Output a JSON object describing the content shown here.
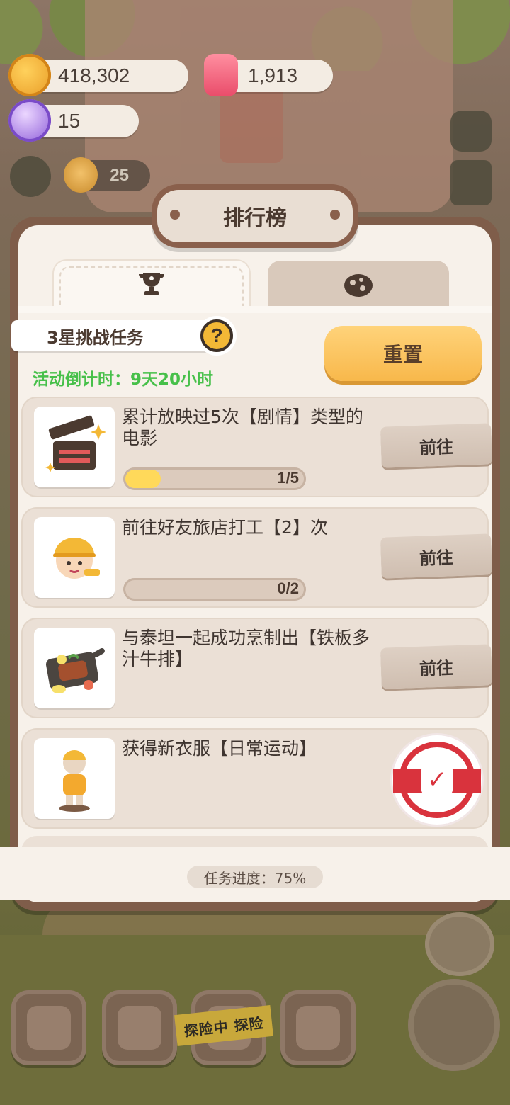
{
  "currencies": {
    "cookie": "418,302",
    "candle": "1,913",
    "gem": "15"
  },
  "level_chip": {
    "value": "25"
  },
  "panel": {
    "title": "排行榜",
    "tabs": [
      {
        "icon": "trophy-icon",
        "active": true
      },
      {
        "icon": "ball-icon",
        "active": false
      }
    ],
    "challenge_label": "3星挑战任务",
    "help_label": "?",
    "countdown": "活动倒计时：9天20小时",
    "reset_label": "重置",
    "tasks": [
      {
        "desc": "累计放映过5次【剧情】类型的电影",
        "progress": 0.2,
        "count": "1/5",
        "button": "前往",
        "icon": "clapperboard-icon"
      },
      {
        "desc": "前往好友旅店打工【2】次",
        "progress": 0,
        "count": "0/2",
        "button": "前往",
        "icon": "worker-character-icon"
      },
      {
        "desc": "与泰坦一起成功烹制出【铁板多汁牛排】",
        "button": "前往",
        "icon": "steak-plate-icon"
      },
      {
        "desc": "获得新衣服【日常运动】",
        "completed": true,
        "icon": "outfit-figure-icon"
      }
    ],
    "progress_footer": "任务进度：75%"
  },
  "bottom_nav": {
    "explore_tape": "探险中 探险"
  },
  "colors": {
    "accent_yellow": "#f8b84b",
    "countdown_green": "#47c04a",
    "stamp_red": "#d9333d",
    "panel_frame": "#7f5d4a"
  }
}
